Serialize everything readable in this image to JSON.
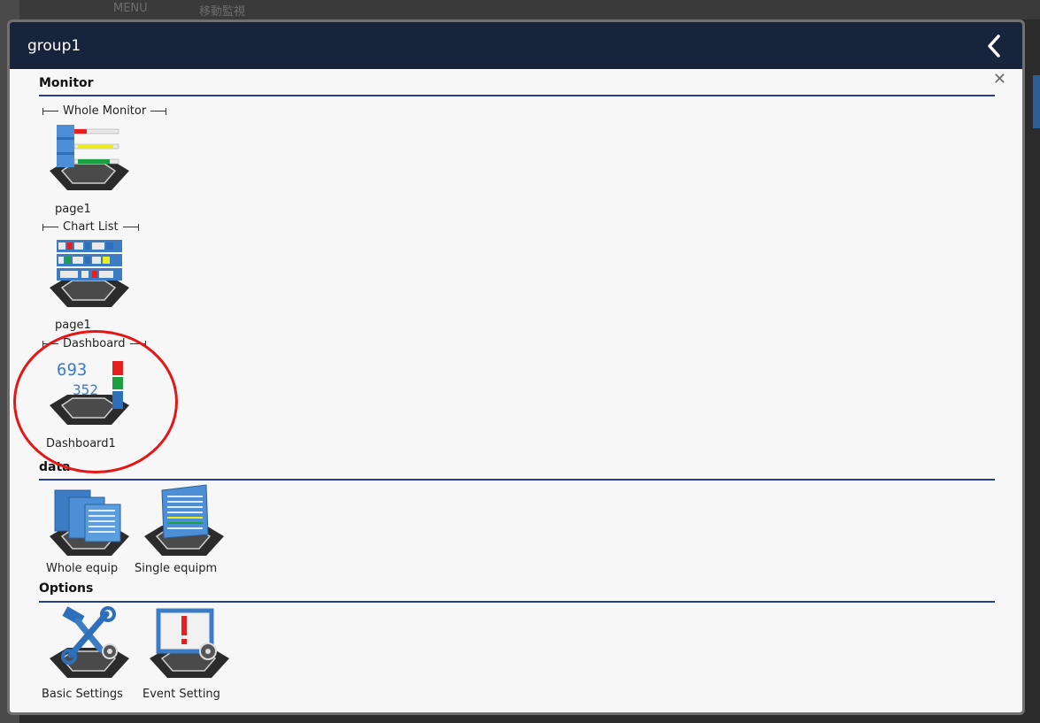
{
  "background": {
    "top_texts": [
      "MENU",
      "移動監視"
    ]
  },
  "modal": {
    "title": "group1",
    "back_icon": "chevron-left-icon",
    "close_icon": "close-icon",
    "close_glyph": "✕"
  },
  "sections": {
    "monitor": {
      "title": "Monitor",
      "groups": {
        "whole_monitor": {
          "label": "Whole Monitor",
          "items": [
            {
              "label": "page1",
              "icon": "whole-monitor-icon"
            }
          ]
        },
        "chart_list": {
          "label": "Chart List",
          "items": [
            {
              "label": "page1",
              "icon": "chart-list-icon"
            }
          ]
        },
        "dashboard": {
          "label": "Dashboard",
          "items": [
            {
              "label": "Dashboard1",
              "icon": "dashboard-icon",
              "digits_top": "693",
              "digits_bottom": "352"
            }
          ]
        }
      }
    },
    "data": {
      "title": "data",
      "items": [
        {
          "label": "Whole equip",
          "icon": "whole-equipment-icon"
        },
        {
          "label": "Single equipm",
          "icon": "single-equipment-icon"
        }
      ]
    },
    "options": {
      "title": "Options",
      "items": [
        {
          "label": "Basic Settings",
          "icon": "basic-settings-icon"
        },
        {
          "label": "Event Setting",
          "icon": "event-setting-icon"
        }
      ]
    }
  },
  "colors": {
    "header_bg": "#18243c",
    "section_rule": "#2a3f8c",
    "annotation": "#e41616"
  }
}
